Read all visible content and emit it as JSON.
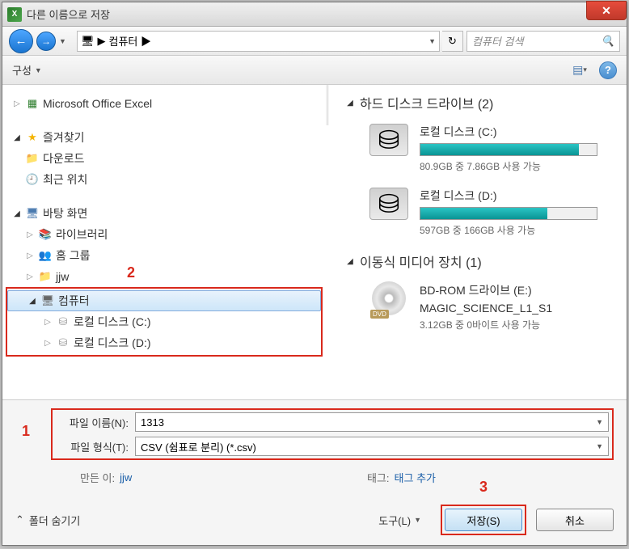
{
  "title": "다른 이름으로 저장",
  "nav": {
    "path_root_icon": "🖥",
    "path": "컴퓨터 ▶",
    "search_placeholder": "컴퓨터 검색"
  },
  "toolbar": {
    "organize": "구성"
  },
  "tree": {
    "excel": "Microsoft Office Excel",
    "favorites": "즐겨찾기",
    "downloads": "다운로드",
    "recent": "최근 위치",
    "desktop": "바탕 화면",
    "libraries": "라이브러리",
    "homegroup": "홈 그룹",
    "user": "jjw",
    "computer": "컴퓨터",
    "drive_c": "로컬 디스크 (C:)",
    "drive_d": "로컬 디스크 (D:)"
  },
  "drives": {
    "hdd_header": "하드 디스크 드라이브 (2)",
    "removable_header": "이동식 미디어 장치 (1)",
    "c": {
      "name": "로컬 디스크 (C:)",
      "fill_pct": 90,
      "status": "80.9GB 중 7.86GB 사용 가능"
    },
    "d": {
      "name": "로컬 디스크 (D:)",
      "fill_pct": 72,
      "status": "597GB 중 166GB 사용 가능"
    },
    "bd": {
      "name": "BD-ROM 드라이브 (E:)",
      "label": "MAGIC_SCIENCE_L1_S1",
      "status": "3.12GB 중 0바이트 사용 가능"
    }
  },
  "form": {
    "filename_label": "파일 이름(N):",
    "filename_value": "1313",
    "filetype_label": "파일 형식(T):",
    "filetype_value": "CSV (쉼표로 분리) (*.csv)",
    "author_label": "만든 이:",
    "author_value": "jjw",
    "tags_label": "태그:",
    "tags_value": "태그 추가"
  },
  "buttons": {
    "tools": "도구(L)",
    "save": "저장(S)",
    "cancel": "취소",
    "hide_folders": "폴더 숨기기"
  },
  "annotations": {
    "a1": "1",
    "a2": "2",
    "a3": "3"
  }
}
